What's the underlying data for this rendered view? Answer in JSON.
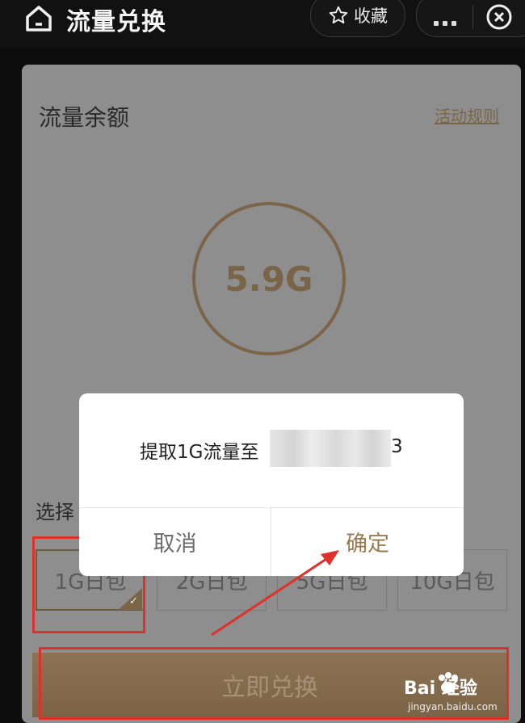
{
  "header": {
    "title": "流量兑换",
    "favorite_label": "收藏"
  },
  "balance": {
    "label": "流量余额",
    "rules_link": "活动规则",
    "value": "5.9G"
  },
  "packages": {
    "label": "选择",
    "items": [
      "1G日包",
      "2G日包",
      "5G日包",
      "10G日包"
    ],
    "selected_index": 0
  },
  "redeem_button": "立即兑换",
  "dialog": {
    "message": "提取1G流量至",
    "message_tail": "3",
    "cancel": "取消",
    "confirm": "确定"
  },
  "watermark": {
    "brand": "Bai  经验",
    "url": "jingyan.baidu.com"
  },
  "colors": {
    "accent": "#9a7a50",
    "annotation": "#e0302a"
  }
}
